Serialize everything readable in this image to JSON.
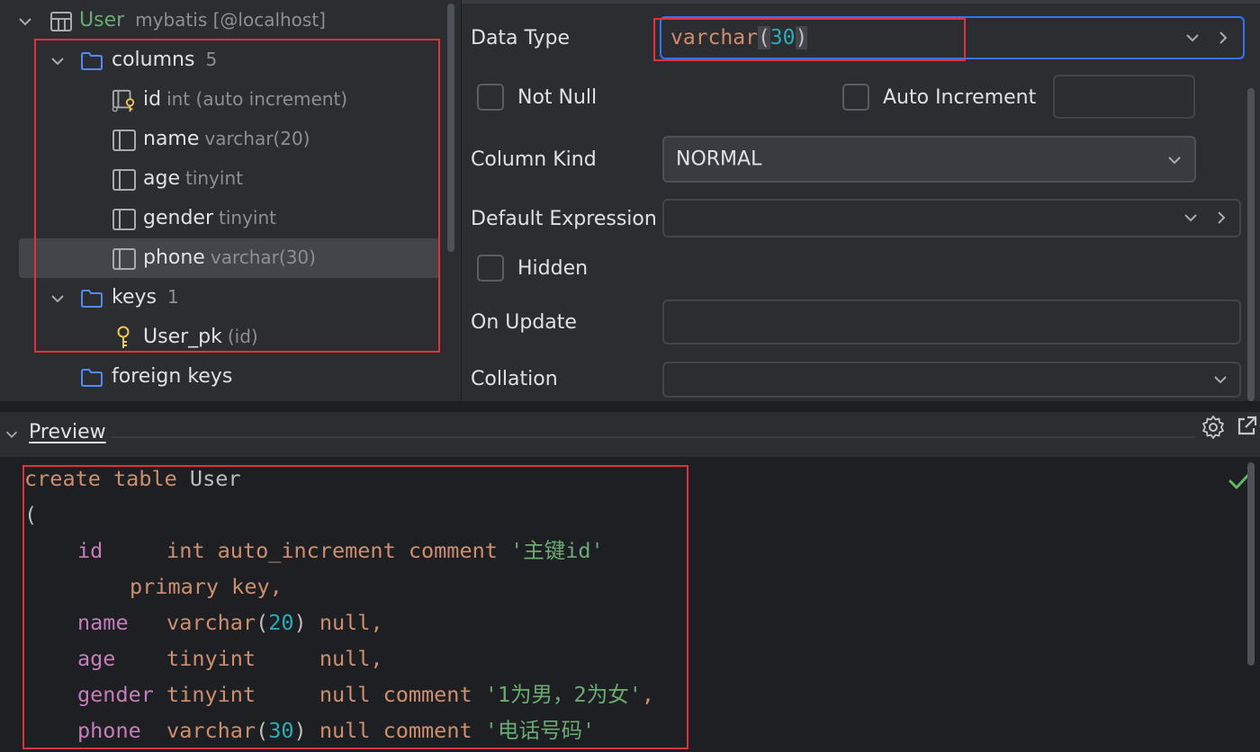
{
  "tree": {
    "table": {
      "name": "User",
      "hint": "mybatis [@localhost]"
    },
    "columns_folder": {
      "label": "columns",
      "count": "5"
    },
    "columns": [
      {
        "name": "id",
        "type": "int (auto increment)"
      },
      {
        "name": "name",
        "type": "varchar(20)"
      },
      {
        "name": "age",
        "type": "tinyint"
      },
      {
        "name": "gender",
        "type": "tinyint"
      },
      {
        "name": "phone",
        "type": "varchar(30)"
      }
    ],
    "keys_folder": {
      "label": "keys",
      "count": "1"
    },
    "keys": [
      {
        "name": "User_pk",
        "hint": "(id)"
      }
    ],
    "foreign_keys_folder": {
      "label": "foreign keys"
    }
  },
  "props": {
    "data_type": {
      "label": "Data Type",
      "value_word": "varchar",
      "value_open": "(",
      "value_num": "30",
      "value_close": ")"
    },
    "not_null": {
      "label": "Not Null",
      "checked": false
    },
    "auto_increment": {
      "label": "Auto Increment",
      "checked": false,
      "value": ""
    },
    "column_kind": {
      "label": "Column Kind",
      "value": "NORMAL"
    },
    "default_expression": {
      "label": "Default Expression",
      "value": ""
    },
    "hidden": {
      "label": "Hidden",
      "checked": false
    },
    "on_update": {
      "label": "On Update",
      "value": ""
    },
    "collation": {
      "label": "Collation",
      "value": ""
    }
  },
  "preview": {
    "title": "Preview",
    "code": {
      "l1_kw": "create table",
      "l1_name": " User",
      "l2": "(",
      "l3_id": "id",
      "l3_pad": "     ",
      "l3_kw": "int auto_increment comment",
      "l3_str": "'主键id'",
      "l4_kw": "primary key",
      "l4_end": ",",
      "l5_id": "name",
      "l5_pad": "   ",
      "l5_kw": "varchar",
      "l5_o": "(",
      "l5_num": "20",
      "l5_c": ")",
      "l5_null": " null",
      "l5_end": ",",
      "l6_id": "age",
      "l6_pad": "    ",
      "l6_kw": "tinyint     null",
      "l6_end": ",",
      "l7_id": "gender",
      "l7_pad": " ",
      "l7_kw": "tinyint     null comment",
      "l7_str": "'1为男，2为女'",
      "l7_end": ",",
      "l8_id": "phone",
      "l8_pad": "  ",
      "l8_kw": "varchar",
      "l8_o": "(",
      "l8_num": "30",
      "l8_c": ")",
      "l8_null": " null comment",
      "l8_str": "'电话号码'"
    }
  },
  "colors": {
    "accent_blue": "#3574f0",
    "highlight_red": "#e0323a",
    "ok_green": "#5fb865"
  },
  "icons": [
    "chevron-down-icon",
    "table-icon",
    "folder-icon",
    "key-column-icon",
    "column-icon",
    "key-icon",
    "chevron-right-icon",
    "gear-icon",
    "open-external-icon",
    "checkmark-icon"
  ]
}
